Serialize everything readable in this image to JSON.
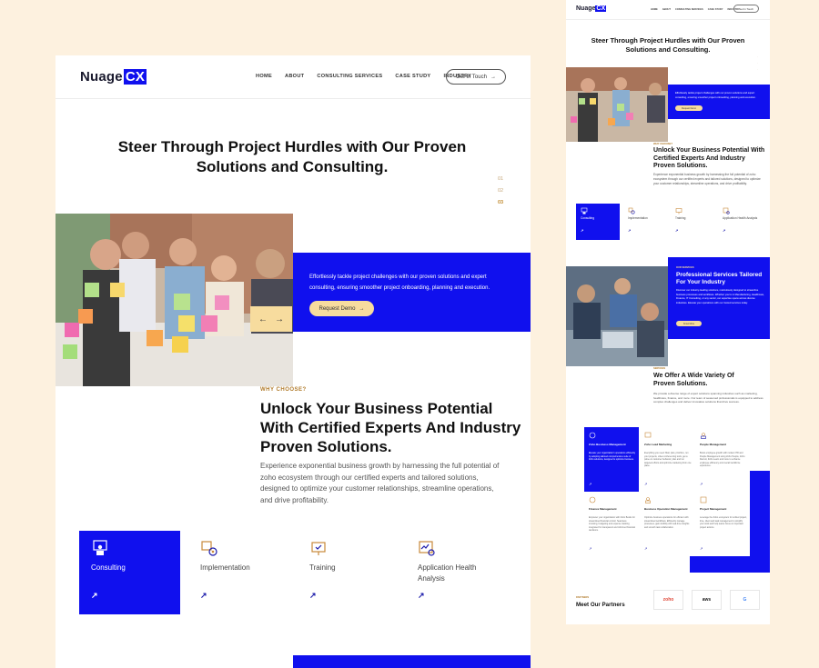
{
  "main": {
    "logo": {
      "text": "Nuage",
      "accent": "CX"
    },
    "nav": [
      "HOME",
      "ABOUT",
      "CONSULTING SERVICES",
      "CASE STUDY",
      "INDUSTRY"
    ],
    "cta": "Get In Touch",
    "hero_title": "Steer Through Project Hurdles with Our Proven Solutions and Consulting.",
    "slides": [
      "01",
      "02",
      "03"
    ],
    "band_text": "Effortlessly tackle project challenges with our proven solutions and expert consulting, ensuring smoother project onboarding, planning and execution.",
    "demo_button": "Request Demo",
    "why_label": "WHY CHOOSE?",
    "why_title": "Unlock Your Business Potential With Certified Experts And Industry Proven Solutions.",
    "why_body": "Experience exponential business growth by harnessing the full potential of zoho ecosystem through our certified experts and tailored solutions, designed to optimize your customer relationships, streamline operations, and drive profitability.",
    "services": [
      "Consulting",
      "Implementation",
      "Training",
      "Application Health Analysis"
    ]
  },
  "side": {
    "logo": {
      "text": "Nuage",
      "accent": "CX"
    },
    "nav": [
      "HOME",
      "ABOUT",
      "CONSULTING SERVICES",
      "CASE STUDY",
      "INDUSTRY"
    ],
    "cta": "Get In Touch",
    "hero_title": "Steer Through Project Hurdles with Our Proven Solutions and Consulting.",
    "band_text": "Effortlessly tackle project challenges with our proven solutions and expert consulting, ensuring smoother project onboarding, planning and execution.",
    "demo_button": "Request Demo",
    "why_label": "WHY CHOOSE?",
    "why_title": "Unlock Your Business Potential With Certified Experts And Industry Proven Solutions.",
    "why_body": "Experience exponential business growth by harnessing the full potential of zoho ecosystem through our certified experts and tailored solutions, designed to optimize your customer relationships, streamline operations, and drive profitability.",
    "services": [
      "Consulting",
      "Implementation",
      "Training",
      "Application Health Analysis"
    ],
    "ps_label": "OUR SERVICES",
    "ps_title": "Professional Services Tailored For Your Industry",
    "ps_body": "Discover our industry-leading solutions, meticulously designed to streamline business processes and workflows. Whether you're in Manufacturing, Healthcare, Finance, IT Consulting, or any sector, our expertise spans across diverse industries. Elevate your operations with our trusted services today.",
    "ps_button": "Know More",
    "offer_label": "SERVICES",
    "offer_title": "We Offer A Wide Variety Of Proven Solutions.",
    "offer_body": "We provide a diverse range of expert solutions spanning industries such as marketing, healthcare, finance, and more. Our team of seasoned professionals is equipped to address complex challenges and deliver innovative solutions that drive success.",
    "offer_cells": [
      {
        "title": "Zoho Business Management",
        "body": "Elevate your organization's operations efficiently by adopting tailored comprehensive suite of Zoho solutions, designed to optimize business."
      },
      {
        "title": "Zoho Lead Marketing",
        "body": "Everything you need: Mail, plan, prioritize, run your projects, video conferencing tools, get a pulse on customer behavior, plan and run targeted efforts and optimize marketing from one place."
      },
      {
        "title": "People Management",
        "body": "Boost employee growth with modern HR and People Management using Zoho People, Zoho Recruit, Zoho Learn and more to enhance employee efficiency and overall workforce experience."
      },
      {
        "title": "Finance Management",
        "body": "Empower your organization with Zoho Books for streamlined financial control. Seamless invoicing, budgeting and expense tracking integrated for transparent and informed financial decisions."
      },
      {
        "title": "Business Operation Management",
        "body": "Optimize business operations for efficient with streamlined workflows. Efficiently manage processes, gain visibility with real-time insights and smooth task collaboration."
      },
      {
        "title": "Project Management",
        "body": "Leverage the Zoho ecosystem for unified project, time, client and task management to simplify your work and help teams focus on important project actions."
      }
    ],
    "partner_label": "PARTNERS",
    "partner_title": "Meet Our Partners",
    "partners": [
      "zoho",
      "aws",
      "G"
    ]
  }
}
